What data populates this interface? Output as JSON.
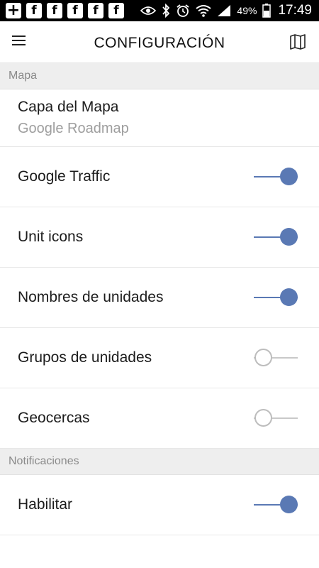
{
  "status_bar": {
    "battery": "49%",
    "time": "17:49"
  },
  "app_bar": {
    "title": "CONFIGURACIÓN"
  },
  "sections": {
    "map": {
      "header": "Mapa",
      "layer": {
        "label": "Capa del Mapa",
        "value": "Google Roadmap"
      },
      "toggles": [
        {
          "label": "Google Traffic",
          "on": true
        },
        {
          "label": "Unit icons",
          "on": true
        },
        {
          "label": "Nombres de unidades",
          "on": true
        },
        {
          "label": "Grupos de unidades",
          "on": false
        },
        {
          "label": "Geocercas",
          "on": false
        }
      ]
    },
    "notifications": {
      "header": "Notificaciones",
      "toggles": [
        {
          "label": "Habilitar",
          "on": true
        }
      ]
    }
  },
  "colors": {
    "accent": "#5a79b4",
    "section_bg": "#eeeeee",
    "status_bar_bg": "#000000"
  }
}
